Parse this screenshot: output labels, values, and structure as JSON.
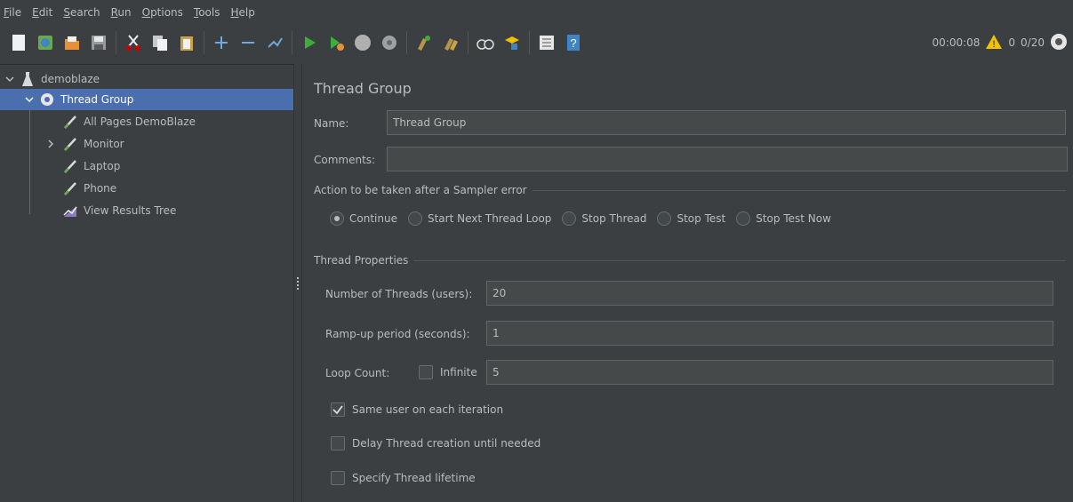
{
  "menu": [
    "File",
    "Edit",
    "Search",
    "Run",
    "Options",
    "Tools",
    "Help"
  ],
  "toolbar": {
    "buttons": [
      "new-icon",
      "templates-icon",
      "open-icon",
      "save-icon",
      "cut-icon",
      "copy-icon",
      "paste-icon",
      "expand-icon",
      "collapse-icon",
      "toggle-icon",
      "start-icon",
      "start-no-pauses-icon",
      "stop-icon",
      "shutdown-icon",
      "clear-icon",
      "clear-all-icon",
      "search-icon",
      "reset-search-icon",
      "function-helper-icon",
      "help-icon"
    ],
    "timer": "00:00:08",
    "warning_count": "0",
    "threads": "0/20"
  },
  "tree": {
    "root": "demoblaze",
    "thread_group": "Thread Group",
    "children": [
      "All Pages DemoBlaze",
      "Monitor",
      "Laptop",
      "Phone",
      "View Results Tree"
    ]
  },
  "panel": {
    "title": "Thread Group",
    "name_label": "Name:",
    "name_value": "Thread Group",
    "comments_label": "Comments:",
    "comments_value": "",
    "sampler_error_section": "Action to be taken after a Sampler error",
    "sampler_error_options": [
      "Continue",
      "Start Next Thread Loop",
      "Stop Thread",
      "Stop Test",
      "Stop Test Now"
    ],
    "sampler_error_selected": "Continue",
    "thread_properties_section": "Thread Properties",
    "threads_label": "Number of Threads (users):",
    "threads_value": "20",
    "rampup_label": "Ramp-up period (seconds):",
    "rampup_value": "1",
    "loop_label": "Loop Count:",
    "infinite_label": "Infinite",
    "infinite_checked": false,
    "loop_value": "5",
    "same_user_label": "Same user on each iteration",
    "same_user_checked": true,
    "delay_label": "Delay Thread creation until needed",
    "delay_checked": false,
    "lifetime_label": "Specify Thread lifetime",
    "lifetime_checked": false
  },
  "colors": {
    "background": "#3c3f41",
    "selection": "#4b6eaf",
    "field": "#45494a",
    "text": "#bbbbbb",
    "start_green": "#3dae3d",
    "warning_yellow": "#f2c200"
  }
}
